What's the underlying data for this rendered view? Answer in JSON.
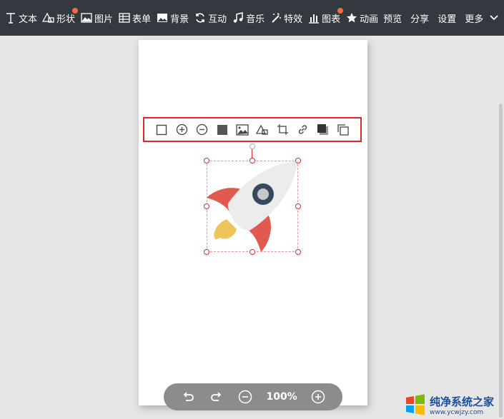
{
  "toolbar": {
    "items": [
      {
        "label": "文本",
        "icon": "text-icon"
      },
      {
        "label": "形状",
        "icon": "shape-icon",
        "badge": true
      },
      {
        "label": "图片",
        "icon": "image-icon"
      },
      {
        "label": "表单",
        "icon": "form-icon"
      },
      {
        "label": "背景",
        "icon": "background-icon"
      },
      {
        "label": "互动",
        "icon": "interact-icon"
      },
      {
        "label": "音乐",
        "icon": "music-icon"
      },
      {
        "label": "特效",
        "icon": "effects-icon"
      },
      {
        "label": "图表",
        "icon": "chart-icon",
        "badge": true
      },
      {
        "label": "动画",
        "icon": "star-icon"
      }
    ],
    "preview": "预览",
    "share": "分享",
    "settings": "设置",
    "more": "更多"
  },
  "element_toolbar": {
    "buttons": [
      "select-frame-icon",
      "zoom-in-icon",
      "zoom-out-icon",
      "fill-icon",
      "image-replace-icon",
      "shape-mask-icon",
      "crop-icon",
      "link-icon",
      "shadow-icon",
      "copy-icon"
    ]
  },
  "zoom": {
    "value": "100%"
  },
  "watermark": {
    "title": "纯净系统之家",
    "url": "www.ycwjzy.com"
  },
  "colors": {
    "topbar": "#34393f",
    "accent": "#e1262b",
    "badge": "#f26b3a",
    "rocket_body": "#ececec",
    "rocket_fin": "#e05a4f",
    "rocket_window": "#344a5e",
    "rocket_flame": "#f0c45c"
  }
}
